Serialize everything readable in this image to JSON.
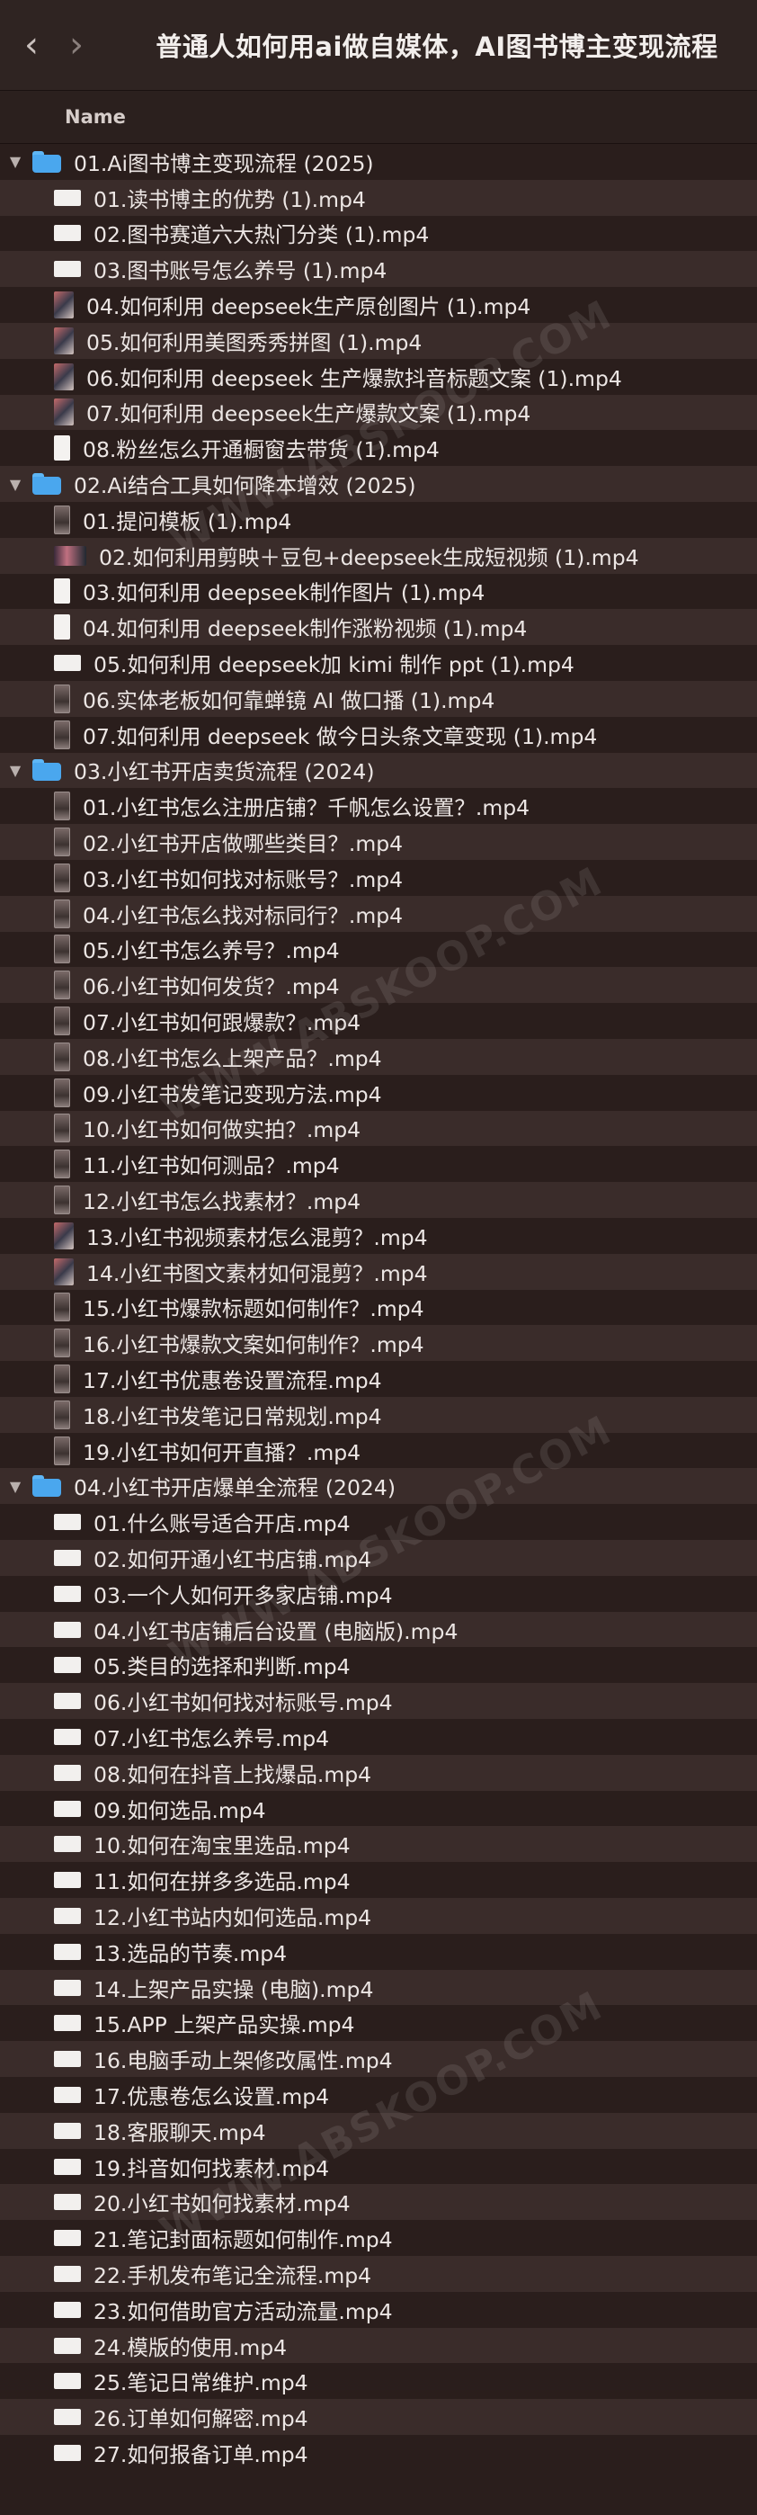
{
  "window": {
    "title": "普通人如何用ai做自媒体，AI图书博主变现流程",
    "back_glyph": "‹",
    "forward_glyph": "›"
  },
  "column_header": {
    "name": "Name"
  },
  "watermark": "WWW.ABSKOOP.COM",
  "rows": [
    {
      "kind": "folder",
      "label": "01.Ai图书博主变现流程 (2025)"
    },
    {
      "kind": "file",
      "thumb": "doc",
      "label": "01.读书博主的优势 (1).mp4"
    },
    {
      "kind": "file",
      "thumb": "doc",
      "label": "02.图书赛道六大热门分类 (1).mp4"
    },
    {
      "kind": "file",
      "thumb": "doc",
      "label": "03.图书账号怎么养号 (1).mp4"
    },
    {
      "kind": "file",
      "thumb": "photo",
      "label": "04.如何利用 deepseek生产原创图片 (1).mp4"
    },
    {
      "kind": "file",
      "thumb": "photo",
      "label": "05.如何利用美图秀秀拼图 (1).mp4"
    },
    {
      "kind": "file",
      "thumb": "photo",
      "label": "06.如何利用 deepseek 生产爆款抖音标题文案 (1).mp4"
    },
    {
      "kind": "file",
      "thumb": "photo",
      "label": "07.如何利用 deepseek生产爆款文案 (1).mp4"
    },
    {
      "kind": "file",
      "thumb": "white-tall",
      "label": "08.粉丝怎么开通橱窗去带货 (1).mp4"
    },
    {
      "kind": "folder",
      "label": "02.Ai结合工具如何降本增效 (2025)"
    },
    {
      "kind": "file",
      "thumb": "tall",
      "label": "01.提问模板 (1).mp4"
    },
    {
      "kind": "file",
      "thumb": "wide",
      "label": "02.如何利用剪映＋豆包+deepseek生成短视频 (1).mp4"
    },
    {
      "kind": "file",
      "thumb": "white-tall",
      "label": "03.如何利用 deepseek制作图片 (1).mp4"
    },
    {
      "kind": "file",
      "thumb": "white-tall",
      "label": "04.如何利用 deepseek制作涨粉视频 (1).mp4"
    },
    {
      "kind": "file",
      "thumb": "doc",
      "label": "05.如何利用 deepseek加 kimi 制作 ppt (1).mp4"
    },
    {
      "kind": "file",
      "thumb": "tall",
      "label": "06.实体老板如何靠蝉镜 AI 做口播 (1).mp4"
    },
    {
      "kind": "file",
      "thumb": "tall",
      "label": "07.如何利用 deepseek 做今日头条文章变现 (1).mp4"
    },
    {
      "kind": "folder",
      "label": "03.小红书开店卖货流程 (2024)"
    },
    {
      "kind": "file",
      "thumb": "tall",
      "label": "01.小红书怎么注册店铺？千帆怎么设置？.mp4"
    },
    {
      "kind": "file",
      "thumb": "tall",
      "label": "02.小红书开店做哪些类目？.mp4"
    },
    {
      "kind": "file",
      "thumb": "tall",
      "label": "03.小红书如何找对标账号？.mp4"
    },
    {
      "kind": "file",
      "thumb": "tall",
      "label": "04.小红书怎么找对标同行？.mp4"
    },
    {
      "kind": "file",
      "thumb": "tall",
      "label": "05.小红书怎么养号？.mp4"
    },
    {
      "kind": "file",
      "thumb": "tall",
      "label": "06.小红书如何发货？.mp4"
    },
    {
      "kind": "file",
      "thumb": "tall",
      "label": "07.小红书如何跟爆款？.mp4"
    },
    {
      "kind": "file",
      "thumb": "tall",
      "label": "08.小红书怎么上架产品？.mp4"
    },
    {
      "kind": "file",
      "thumb": "tall",
      "label": "09.小红书发笔记变现方法.mp4"
    },
    {
      "kind": "file",
      "thumb": "tall",
      "label": "10.小红书如何做实拍？.mp4"
    },
    {
      "kind": "file",
      "thumb": "tall",
      "label": "11.小红书如何测品？.mp4"
    },
    {
      "kind": "file",
      "thumb": "tall",
      "label": "12.小红书怎么找素材？.mp4"
    },
    {
      "kind": "file",
      "thumb": "photo",
      "label": "13.小红书视频素材怎么混剪？.mp4"
    },
    {
      "kind": "file",
      "thumb": "photo",
      "label": "14.小红书图文素材如何混剪？.mp4"
    },
    {
      "kind": "file",
      "thumb": "tall",
      "label": "15.小红书爆款标题如何制作？.mp4"
    },
    {
      "kind": "file",
      "thumb": "tall",
      "label": "16.小红书爆款文案如何制作？.mp4"
    },
    {
      "kind": "file",
      "thumb": "tall",
      "label": "17.小红书优惠卷设置流程.mp4"
    },
    {
      "kind": "file",
      "thumb": "tall",
      "label": "18.小红书发笔记日常规划.mp4"
    },
    {
      "kind": "file",
      "thumb": "tall",
      "label": "19.小红书如何开直播？.mp4"
    },
    {
      "kind": "folder",
      "label": "04.小红书开店爆单全流程 (2024)"
    },
    {
      "kind": "file",
      "thumb": "doc",
      "label": "01.什么账号适合开店.mp4"
    },
    {
      "kind": "file",
      "thumb": "doc",
      "label": "02.如何开通小红书店铺.mp4"
    },
    {
      "kind": "file",
      "thumb": "doc",
      "label": "03.一个人如何开多家店铺.mp4"
    },
    {
      "kind": "file",
      "thumb": "doc",
      "label": "04.小红书店铺后台设置 (电脑版).mp4"
    },
    {
      "kind": "file",
      "thumb": "doc",
      "label": "05.类目的选择和判断.mp4"
    },
    {
      "kind": "file",
      "thumb": "doc",
      "label": "06.小红书如何找对标账号.mp4"
    },
    {
      "kind": "file",
      "thumb": "doc",
      "label": "07.小红书怎么养号.mp4"
    },
    {
      "kind": "file",
      "thumb": "doc",
      "label": "08.如何在抖音上找爆品.mp4"
    },
    {
      "kind": "file",
      "thumb": "doc",
      "label": "09.如何选品.mp4"
    },
    {
      "kind": "file",
      "thumb": "doc",
      "label": "10.如何在淘宝里选品.mp4"
    },
    {
      "kind": "file",
      "thumb": "doc",
      "label": "11.如何在拼多多选品.mp4"
    },
    {
      "kind": "file",
      "thumb": "doc",
      "label": "12.小红书站内如何选品.mp4"
    },
    {
      "kind": "file",
      "thumb": "doc",
      "label": "13.选品的节奏.mp4"
    },
    {
      "kind": "file",
      "thumb": "doc",
      "label": "14.上架产品实操 (电脑).mp4"
    },
    {
      "kind": "file",
      "thumb": "doc",
      "label": "15.APP 上架产品实操.mp4"
    },
    {
      "kind": "file",
      "thumb": "doc",
      "label": "16.电脑手动上架修改属性.mp4"
    },
    {
      "kind": "file",
      "thumb": "doc",
      "label": "17.优惠卷怎么设置.mp4"
    },
    {
      "kind": "file",
      "thumb": "doc",
      "label": "18.客服聊天.mp4"
    },
    {
      "kind": "file",
      "thumb": "doc",
      "label": "19.抖音如何找素材.mp4"
    },
    {
      "kind": "file",
      "thumb": "doc",
      "label": "20.小红书如何找素材.mp4"
    },
    {
      "kind": "file",
      "thumb": "doc",
      "label": "21.笔记封面标题如何制作.mp4"
    },
    {
      "kind": "file",
      "thumb": "doc",
      "label": "22.手机发布笔记全流程.mp4"
    },
    {
      "kind": "file",
      "thumb": "doc",
      "label": "23.如何借助官方活动流量.mp4"
    },
    {
      "kind": "file",
      "thumb": "doc",
      "label": "24.模版的使用.mp4"
    },
    {
      "kind": "file",
      "thumb": "doc",
      "label": "25.笔记日常维护.mp4"
    },
    {
      "kind": "file",
      "thumb": "doc",
      "label": "26.订单如何解密.mp4"
    },
    {
      "kind": "file",
      "thumb": "doc",
      "label": "27.如何报备订单.mp4"
    }
  ]
}
